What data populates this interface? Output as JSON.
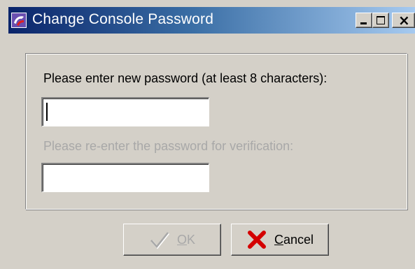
{
  "window": {
    "title": "Change Console Password",
    "close_glyph": "×",
    "icon": "app-logo-icon"
  },
  "form": {
    "new_password_label": "Please enter new password (at least 8 characters):",
    "new_password_value": "",
    "verify_label": "Please re-enter the password for verification:",
    "verify_value": ""
  },
  "buttons": {
    "ok": {
      "label": "OK",
      "mnemonic": "O",
      "rest": "K",
      "icon": "checkmark-icon",
      "enabled": false
    },
    "cancel": {
      "label": "Cancel",
      "mnemonic": "C",
      "rest": "ancel",
      "icon": "red-x-icon",
      "enabled": true
    }
  },
  "colors": {
    "titlebar_start": "#0a246a",
    "titlebar_end": "#a6caf0",
    "face": "#d4d0c8",
    "disabled_text": "#a8a8a8",
    "cancel_x": "#d40000"
  }
}
